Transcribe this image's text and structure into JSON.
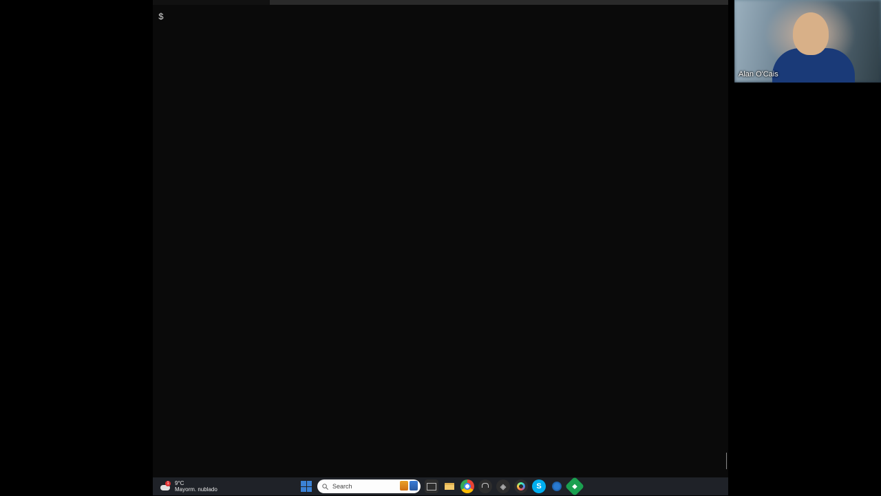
{
  "terminal": {
    "prompt": "$"
  },
  "taskbar": {
    "weather": {
      "badge": "1",
      "temp": "9°C",
      "condition": "Mayorm. nublado"
    },
    "search_placeholder": "Search",
    "icons": {
      "start": "start-icon",
      "search": "search-icon",
      "taskview": "taskview-icon",
      "explorer": "file-explorer-icon",
      "chrome": "chrome-icon",
      "lock": "lock-icon",
      "cube": "cube-icon",
      "hub": "color-ring-icon",
      "skype": "skype-icon",
      "skype_label": "S",
      "globe": "globe-icon",
      "green": "green-diamond-icon"
    }
  },
  "webcam": {
    "speaker_name": "Alan O'Cais"
  }
}
